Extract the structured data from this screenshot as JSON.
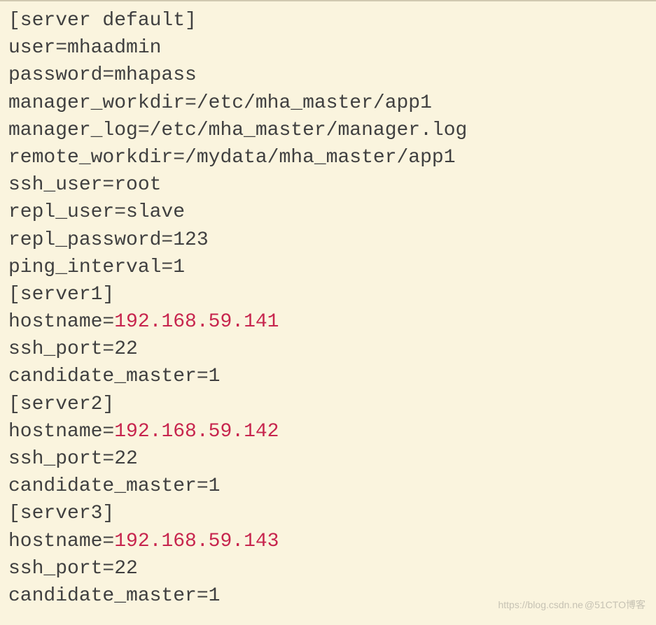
{
  "config": {
    "section_default": "[server default]",
    "user": "user=mhaadmin",
    "password": "password=mhapass",
    "manager_workdir": "manager_workdir=/etc/mha_master/app1",
    "manager_log": "manager_log=/etc/mha_master/manager.log",
    "remote_workdir": "remote_workdir=/mydata/mha_master/app1",
    "ssh_user": "ssh_user=root",
    "repl_user": "repl_user=slave",
    "repl_password": "repl_password=123",
    "ping_interval": "ping_interval=1",
    "section_server1": "[server1]",
    "hostname1_prefix": "hostname=",
    "hostname1_ip": "192.168.59.141",
    "ssh_port1": "ssh_port=22",
    "candidate_master1": "candidate_master=1",
    "section_server2": "[server2]",
    "hostname2_prefix": "hostname=",
    "hostname2_ip": "192.168.59.142",
    "ssh_port2": "ssh_port=22",
    "candidate_master2": "candidate_master=1",
    "section_server3": "[server3]",
    "hostname3_prefix": "hostname=",
    "hostname3_ip": "192.168.59.143",
    "ssh_port3": "ssh_port=22",
    "candidate_master3": "candidate_master=1"
  },
  "watermark": {
    "left": "https://blog.csdn.ne",
    "right": "@51CTO博客"
  }
}
